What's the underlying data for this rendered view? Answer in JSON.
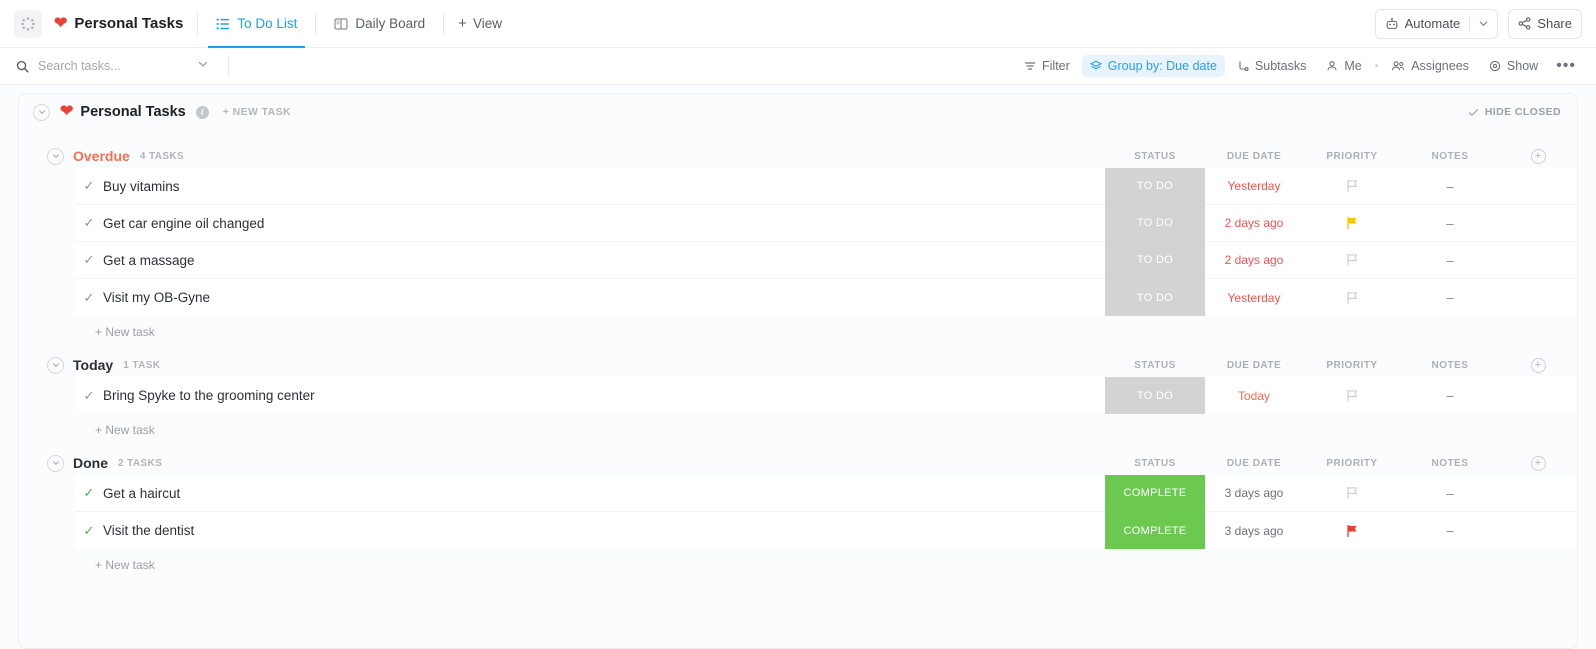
{
  "topbar": {
    "space_icon": "heart-icon",
    "space_title": "Personal Tasks",
    "tabs": [
      {
        "label": "To Do List",
        "icon": "list-view-icon",
        "active": true
      },
      {
        "label": "Daily Board",
        "icon": "board-view-icon",
        "active": false
      }
    ],
    "add_view_label": "View",
    "automate_label": "Automate",
    "share_label": "Share"
  },
  "filterbar": {
    "search_placeholder": "Search tasks...",
    "search_value": "",
    "tools": [
      {
        "label": "Filter",
        "icon": "filter-icon",
        "active": false
      },
      {
        "label": "Group by: Due date",
        "icon": "layers-icon",
        "active": true
      },
      {
        "label": "Subtasks",
        "icon": "subtask-icon",
        "active": false
      },
      {
        "label": "Me",
        "icon": "person-icon",
        "active": false
      },
      {
        "label": "Assignees",
        "icon": "people-icon",
        "active": false
      },
      {
        "label": "Show",
        "icon": "eye-icon",
        "active": false
      }
    ],
    "more_label": "•••"
  },
  "list": {
    "title": "Personal Tasks",
    "new_task_label": "+ NEW TASK",
    "hide_closed_label": "HIDE CLOSED",
    "columns": [
      "STATUS",
      "DUE DATE",
      "PRIORITY",
      "NOTES"
    ],
    "new_task_row_label": "+ New task"
  },
  "groups": [
    {
      "name": "Overdue",
      "count_label": "4 TASKS",
      "color": "#f0704f",
      "tasks": [
        {
          "name": "Buy vitamins",
          "status": "TO DO",
          "status_kind": "todo",
          "due": "Yesterday",
          "due_kind": "red",
          "priority": "none",
          "notes": "–"
        },
        {
          "name": "Get car engine oil changed",
          "status": "TO DO",
          "status_kind": "todo",
          "due": "2 days ago",
          "due_kind": "red",
          "priority": "yellow",
          "notes": "–"
        },
        {
          "name": "Get a massage",
          "status": "TO DO",
          "status_kind": "todo",
          "due": "2 days ago",
          "due_kind": "red",
          "priority": "none",
          "notes": "–"
        },
        {
          "name": "Visit my OB-Gyne",
          "status": "TO DO",
          "status_kind": "todo",
          "due": "Yesterday",
          "due_kind": "red",
          "priority": "none",
          "notes": "–"
        }
      ]
    },
    {
      "name": "Today",
      "count_label": "1 TASK",
      "color": "#2a2f37",
      "tasks": [
        {
          "name": "Bring Spyke to the grooming center",
          "status": "TO DO",
          "status_kind": "todo",
          "due": "Today",
          "due_kind": "orange",
          "priority": "none",
          "notes": "–"
        }
      ]
    },
    {
      "name": "Done",
      "count_label": "2 TASKS",
      "color": "#2a2f37",
      "tasks": [
        {
          "name": "Get a haircut",
          "status": "COMPLETE",
          "status_kind": "complete",
          "due": "3 days ago",
          "due_kind": "gray",
          "priority": "none",
          "notes": "–",
          "checked": true
        },
        {
          "name": "Visit the dentist",
          "status": "COMPLETE",
          "status_kind": "complete",
          "due": "3 days ago",
          "due_kind": "gray",
          "priority": "red",
          "notes": "–",
          "checked": true
        }
      ]
    }
  ],
  "colors": {
    "accent_blue": "#1e9ef5",
    "overdue_orange": "#f0704f",
    "due_red": "#ef5350",
    "complete_green": "#6bc950",
    "todo_gray": "#d3d3d3",
    "priority_yellow": "#fec400",
    "priority_red": "#ef3b2d"
  }
}
